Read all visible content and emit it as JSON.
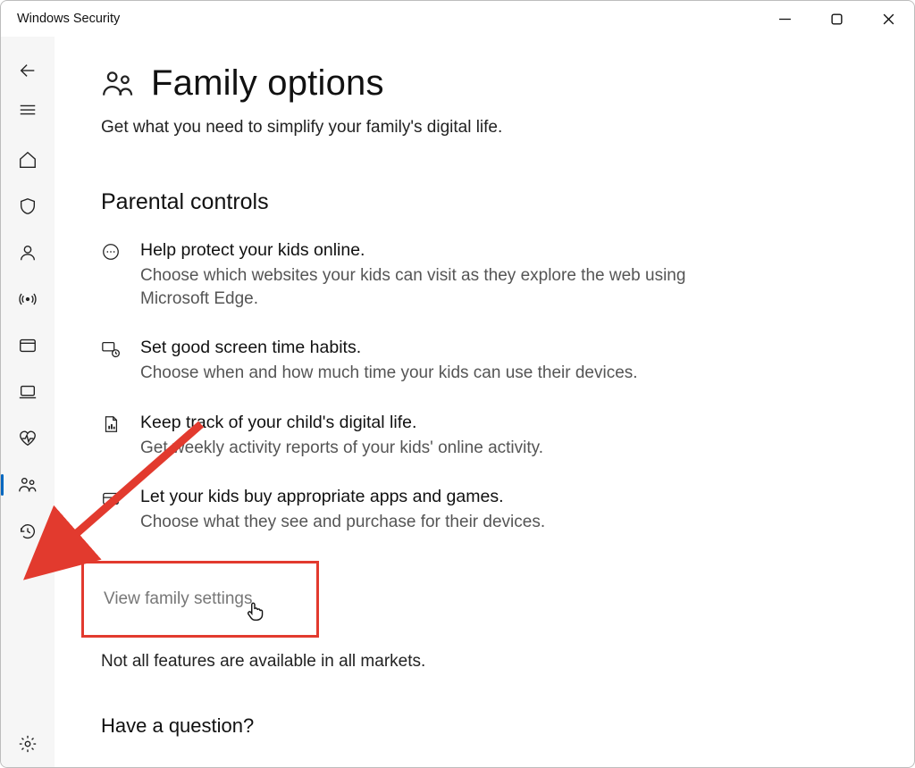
{
  "window": {
    "title": "Windows Security"
  },
  "header": {
    "title": "Family options",
    "subtitle": "Get what you need to simplify your family's digital life."
  },
  "section": {
    "heading": "Parental controls"
  },
  "items": [
    {
      "title": "Help protect your kids online.",
      "desc": "Choose which websites your kids can visit as they explore the web using Microsoft Edge."
    },
    {
      "title": "Set good screen time habits.",
      "desc": "Choose when and how much time your kids can use their devices."
    },
    {
      "title": "Keep track of your child's digital life.",
      "desc": "Get weekly activity reports of your kids' online activity."
    },
    {
      "title": "Let your kids buy appropriate apps and games.",
      "desc": "Choose what they see and purchase for their devices."
    }
  ],
  "link": {
    "label": "View family settings"
  },
  "footnote": "Not all features are available in all markets.",
  "question": {
    "heading": "Have a question?"
  }
}
